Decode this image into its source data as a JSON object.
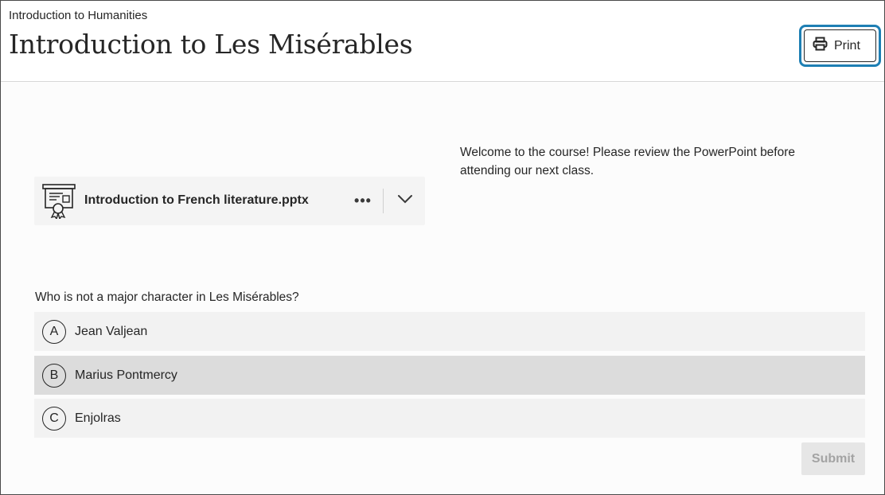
{
  "header": {
    "breadcrumb": "Introduction to Humanities",
    "title": "Introduction to Les Misérables",
    "print_label": "Print",
    "print_icon": "printer-icon"
  },
  "attachment": {
    "icon": "presentation-file-icon",
    "file_name": "Introduction to French literature.pptx",
    "more_label": "•••",
    "expand_icon": "chevron-down-icon"
  },
  "welcome_text": "Welcome to the course! Please review the PowerPoint before attending our next class.",
  "quiz": {
    "question": "Who is not a major character in Les Misérables?",
    "options": [
      {
        "letter": "A",
        "text": "Jean Valjean"
      },
      {
        "letter": "B",
        "text": "Marius Pontmercy"
      },
      {
        "letter": "C",
        "text": "Enjolras"
      }
    ],
    "highlighted_option": "B",
    "submit_label": "Submit"
  },
  "colors": {
    "focus_ring": "#1e7fb4",
    "text": "#262626",
    "option_bg": "#f2f2f2",
    "option_hover_bg": "#dcdcdc",
    "submit_disabled_text": "#a3a3a3"
  }
}
